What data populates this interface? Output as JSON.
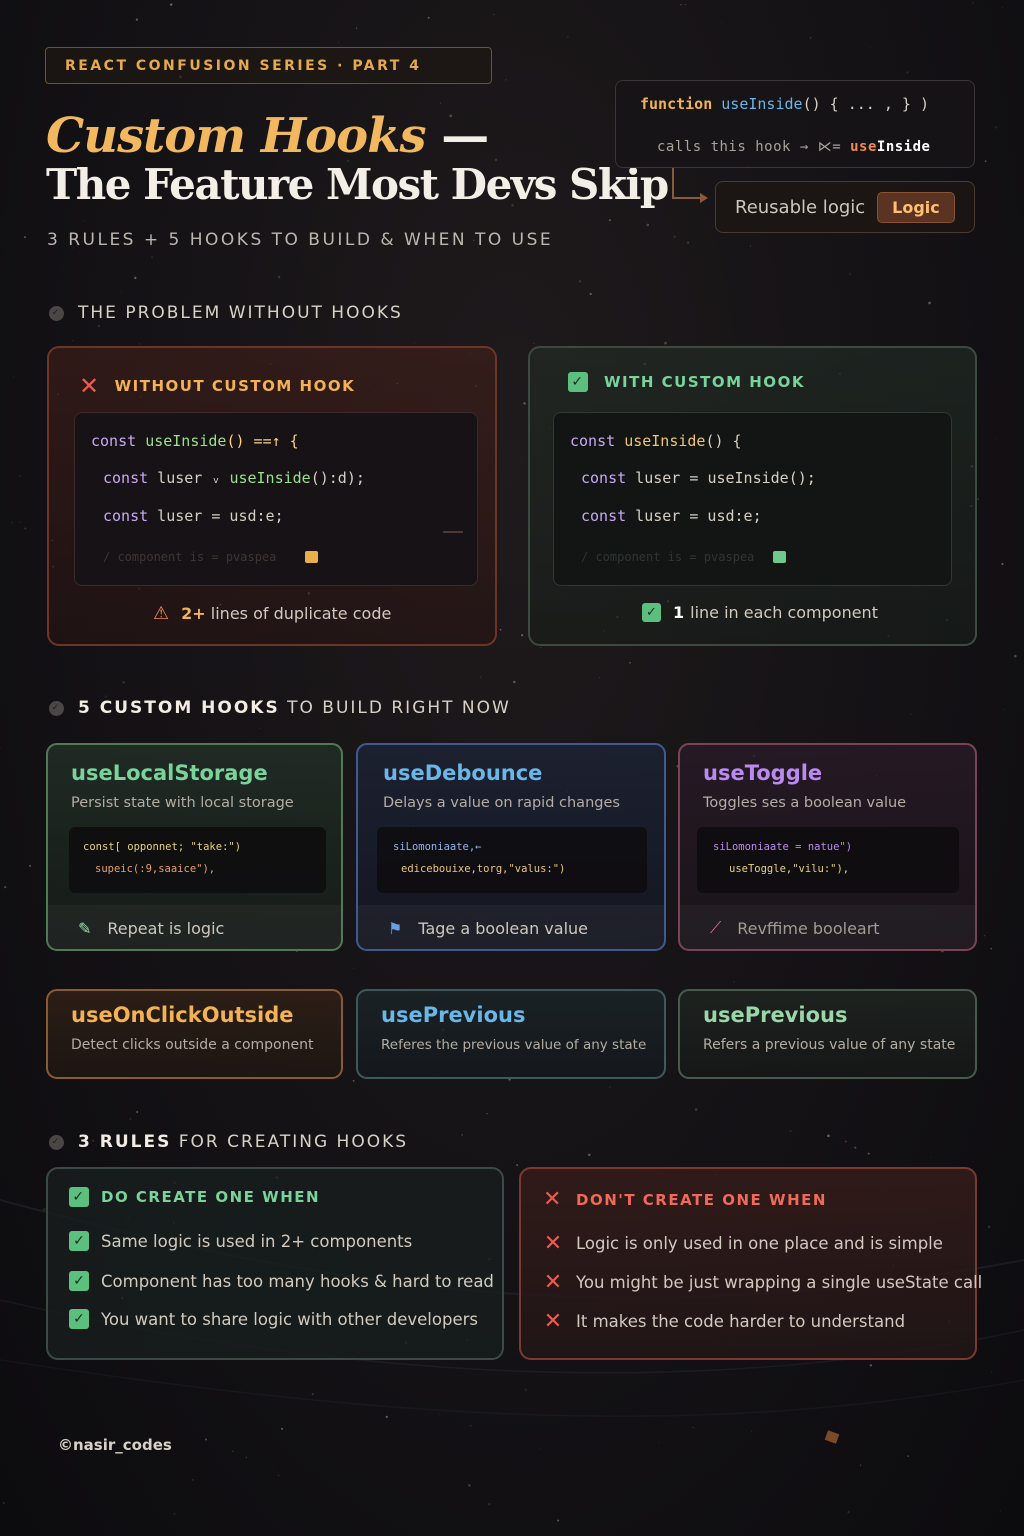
{
  "header": {
    "series_badge": "REACT CONFUSION  SERIES · PART 4",
    "title_line1": "Custom Hooks",
    "title_dash": "—",
    "title_line2": "The Feature Most Devs Skip",
    "subtitle": "3 RULES + 5 HOOKS TO BUILD & WHEN TO USE"
  },
  "function_card": {
    "keyword": "function",
    "name": "useInside",
    "signature": "() {  ... , } )",
    "calls_text": "calls  this hook → ⋉=",
    "calls_hook": "useInside"
  },
  "reusable_card": {
    "label": "Reusable logic",
    "badge": "Logic"
  },
  "section_problem": "THE PROBLEM WITHOUT HOOKS",
  "problem": {
    "bad": {
      "title": "WITHOUT CUSTOM HOOK",
      "code": [
        {
          "kw": "const",
          "fn": "useInside",
          "rest": "() ==↑ {"
        },
        {
          "kw": "const",
          "mid": " luser ᵥ ",
          "fn": "useInside",
          "rest": "():d);"
        },
        {
          "kw": "const",
          "mid": " luser = usd:e;"
        }
      ],
      "faded": "/ component is = pvaspea",
      "foot_num": "2+",
      "foot_text": "lines of duplicate code"
    },
    "good": {
      "title": "WITH CUSTOM HOOK",
      "code": [
        {
          "kw": "const",
          "fn": "useInside",
          "rest": "() {"
        },
        {
          "kw": "const",
          "mid": " luser = ",
          "fn": "useInside",
          "rest": "();"
        },
        {
          "kw": "const",
          "mid": " luser = usd:e;"
        }
      ],
      "faded": "/ component is = pvaspea",
      "foot_num": "1",
      "foot_text": "line in each component"
    }
  },
  "section_hooks": {
    "bold": "5 CUSTOM HOOKS",
    "rest": "TO BUILD RIGHT NOW"
  },
  "hooks": [
    {
      "name": "useLocalStorage",
      "desc": "Persist state with local storage",
      "code1": "const[ opponnet; \"take:\")",
      "code2": "supeic(:9,saaice\"),",
      "foot": "Repeat is logic",
      "foot_icon": "pencil-icon",
      "color": "#7ad39a"
    },
    {
      "name": "useDebounce",
      "desc": "Delays a value  on rapid changes",
      "code1": "siLomoniaate,←",
      "code2": "edicebouixe,torg,\"valus:\")",
      "foot": "Tage a boolean value",
      "foot_icon": "flag-icon",
      "color": "#6ab6e6"
    },
    {
      "name": "useToggle",
      "desc": "Toggles ses a boolean value",
      "code1": "siLomoniaate = natue\")",
      "code2": "useToggle,\"vilu:\"),",
      "foot": "Revffime booleart",
      "foot_icon": "toggle-icon",
      "color": "#b98af0"
    },
    {
      "name": "useOnClickOutside",
      "desc": "Detect clicks outside a component",
      "color": "#f2b255"
    },
    {
      "name": "usePrevious",
      "desc": "Referes the previous value of any state",
      "color": "#6ab6e6"
    },
    {
      "name": "usePrevious",
      "desc": "Refers a previous value of any state",
      "color": "#9bd6a8"
    }
  ],
  "section_rules": {
    "bold": "3 RULES",
    "rest": "FOR CREATING HOOKS"
  },
  "rules": {
    "do": {
      "title": "DO CREATE ONE WHEN",
      "items": [
        "Same logic is used in 2+ components",
        "Component has too many hooks & hard to read",
        "You want to share logic with other developers"
      ]
    },
    "dont": {
      "title": "DON'T CREATE ONE WHEN",
      "items": [
        "Logic is only used in one place and is simple",
        "You might be just wrapping a single useState call",
        "It makes the code harder to understand"
      ]
    }
  },
  "footer": {
    "handle": "©nasir_codes"
  }
}
